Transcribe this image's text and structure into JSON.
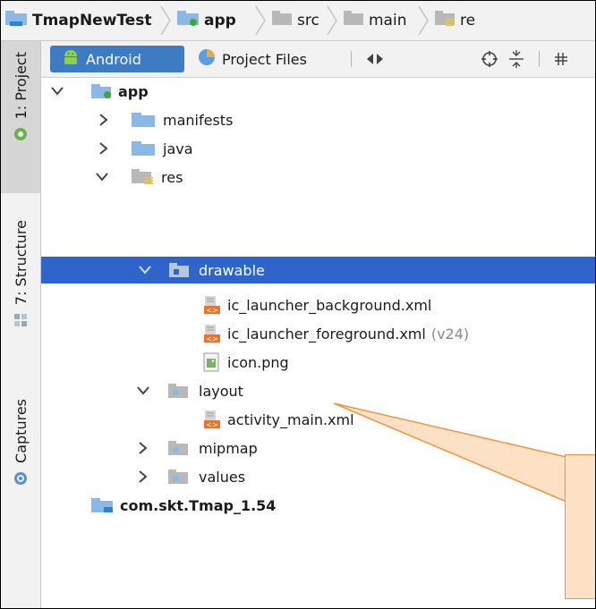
{
  "navbar": {
    "crumbs": [
      {
        "label": "TmapNewTest",
        "icon": "module-folder-icon"
      },
      {
        "label": "app",
        "icon": "app-module-icon"
      },
      {
        "label": "src",
        "icon": "folder-icon"
      },
      {
        "label": "main",
        "icon": "folder-icon"
      },
      {
        "label": "re",
        "icon": "res-folder-icon"
      }
    ]
  },
  "sidebar": {
    "tabs": [
      {
        "label": "1: Project",
        "icon": "android-project-icon",
        "active": true
      },
      {
        "label": "7: Structure",
        "icon": "structure-icon",
        "active": false
      },
      {
        "label": "Captures",
        "icon": "captures-icon",
        "active": false
      }
    ]
  },
  "toolbar": {
    "android_label": "Android",
    "project_files_label": "Project Files",
    "icons": [
      "swap-arrows-icon",
      "locate-target-icon",
      "collapse-all-icon"
    ]
  },
  "tree": {
    "items": [
      {
        "label": "app",
        "icon": "app-module-icon",
        "state": "expanded",
        "level": 0,
        "bold": true
      },
      {
        "label": "manifests",
        "icon": "folder-icon",
        "state": "collapsed",
        "level": 1
      },
      {
        "label": "java",
        "icon": "folder-icon",
        "state": "collapsed",
        "level": 1
      },
      {
        "label": "res",
        "icon": "res-folder-icon",
        "state": "expanded",
        "level": 1
      },
      {
        "label": "drawable",
        "icon": "folder-icon",
        "state": "expanded",
        "level": 2,
        "selected": true
      },
      {
        "label": "ic_launcher_background.xml",
        "icon": "xml-file-icon",
        "level": 3
      },
      {
        "label": "ic_launcher_foreground.xml",
        "icon": "xml-file-icon",
        "level": 3,
        "extra": "(v24)"
      },
      {
        "label": "icon.png",
        "icon": "image-file-icon",
        "level": 3
      },
      {
        "label": "layout",
        "icon": "folder-icon",
        "state": "expanded",
        "level": 2
      },
      {
        "label": "activity_main.xml",
        "icon": "xml-file-icon",
        "level": 3
      },
      {
        "label": "mipmap",
        "icon": "folder-icon",
        "state": "collapsed",
        "level": 2
      },
      {
        "label": "values",
        "icon": "folder-icon",
        "state": "collapsed",
        "level": 2
      },
      {
        "label": "com.skt.Tmap_1.54",
        "icon": "library-module-icon",
        "level": 0,
        "bold": true
      }
    ]
  },
  "colors": {
    "selection": "#2f65ca",
    "folder": "#8cb8e6",
    "res_accent": "#e8c44a",
    "callout_fill": "#fce1c4",
    "callout_border": "#f0943c"
  }
}
